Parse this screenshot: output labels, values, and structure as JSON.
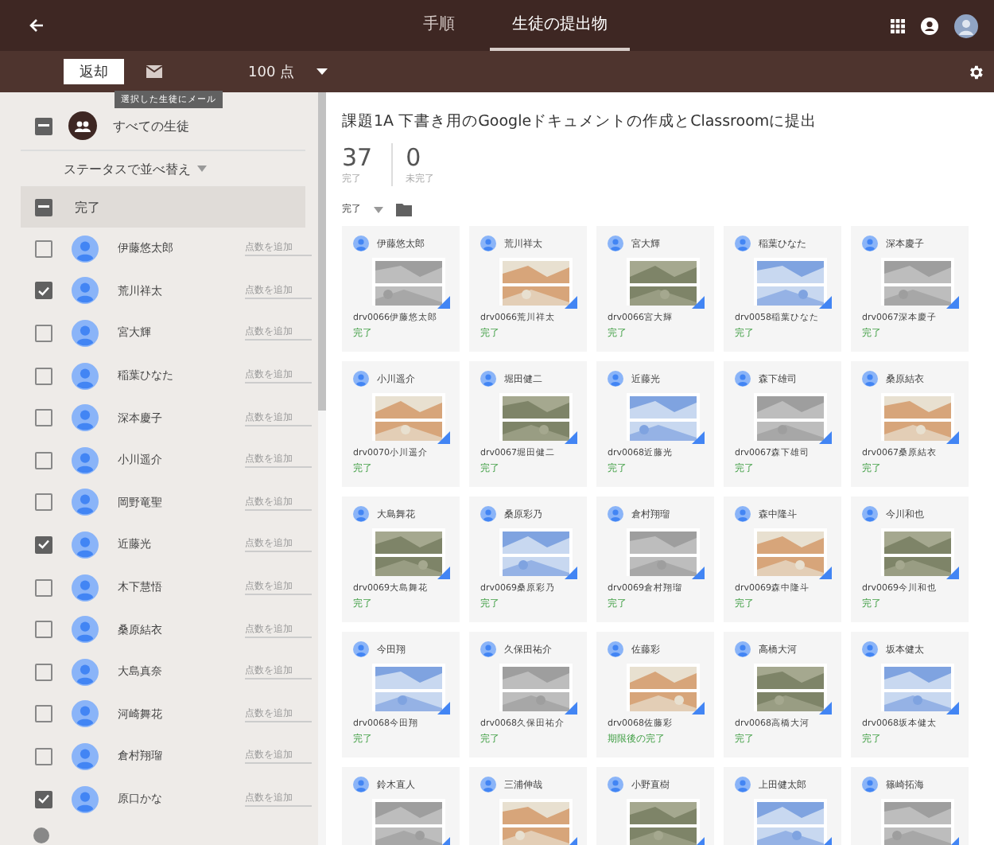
{
  "topbar": {
    "tabs": [
      {
        "label": "手順",
        "selected": false
      },
      {
        "label": "生徒の提出物",
        "selected": true
      }
    ]
  },
  "toolbar": {
    "return_button": "返却",
    "points": "100 点",
    "tooltip": "選択した生徒にメール"
  },
  "sidebar": {
    "all_students": "すべての生徒",
    "all_indeterminate": true,
    "sort": "ステータスで並べ替え",
    "section": "完了",
    "section_indeterminate": true,
    "students": [
      {
        "name": "伊藤悠太郎",
        "checked": false,
        "placeholder": "点数を追加"
      },
      {
        "name": "荒川祥太",
        "checked": true,
        "placeholder": "点数を追加"
      },
      {
        "name": "宮大輝",
        "checked": false,
        "placeholder": "点数を追加"
      },
      {
        "name": "稲葉ひなた",
        "checked": false,
        "placeholder": "点数を追加"
      },
      {
        "name": "深本慶子",
        "checked": false,
        "placeholder": "点数を追加"
      },
      {
        "name": "小川遥介",
        "checked": false,
        "placeholder": "点数を追加"
      },
      {
        "name": "岡野竜聖",
        "checked": false,
        "placeholder": "点数を追加"
      },
      {
        "name": "近藤光",
        "checked": true,
        "placeholder": "点数を追加"
      },
      {
        "name": "木下慧悟",
        "checked": false,
        "placeholder": "点数を追加"
      },
      {
        "name": "桑原結衣",
        "checked": false,
        "placeholder": "点数を追加"
      },
      {
        "name": "大島真奈",
        "checked": false,
        "placeholder": "点数を追加"
      },
      {
        "name": "河崎舞花",
        "checked": false,
        "placeholder": "点数を追加"
      },
      {
        "name": "倉村翔瑠",
        "checked": false,
        "placeholder": "点数を追加"
      },
      {
        "name": "原口かな",
        "checked": true,
        "placeholder": "点数を追加"
      }
    ]
  },
  "assignment": {
    "title": "課題1A 下書き用のGoogleドキュメントの作成とClassroomに提出",
    "stats": [
      {
        "value": "37",
        "label": "完了"
      },
      {
        "value": "0",
        "label": "未完了"
      }
    ],
    "filter": "完了",
    "cards": [
      {
        "name": "伊藤悠太郎",
        "file": "drv0066伊藤悠太郎",
        "status": "完了"
      },
      {
        "name": "荒川祥太",
        "file": "drv0066荒川祥太",
        "status": "完了"
      },
      {
        "name": "宮大輝",
        "file": "drv0066宮大輝",
        "status": "完了"
      },
      {
        "name": "稲葉ひなた",
        "file": "drv0058稲葉ひなた",
        "status": "完了"
      },
      {
        "name": "深本慶子",
        "file": "drv0067深本慶子",
        "status": "完了"
      },
      {
        "name": "小川遥介",
        "file": "drv0070小川遥介",
        "status": "完了"
      },
      {
        "name": "堀田健二",
        "file": "drv0067堀田健二",
        "status": "完了"
      },
      {
        "name": "近藤光",
        "file": "drv0068近藤光",
        "status": "完了"
      },
      {
        "name": "森下雄司",
        "file": "drv0067森下雄司",
        "status": "完了"
      },
      {
        "name": "桑原結衣",
        "file": "drv0067桑原結衣",
        "status": "完了"
      },
      {
        "name": "大島舞花",
        "file": "drv0069大島舞花",
        "status": "完了"
      },
      {
        "name": "桑原彩乃",
        "file": "drv0069桑原彩乃",
        "status": "完了"
      },
      {
        "name": "倉村翔瑠",
        "file": "drv0069倉村翔瑠",
        "status": "完了"
      },
      {
        "name": "森中隆斗",
        "file": "drv0069森中隆斗",
        "status": "完了"
      },
      {
        "name": "今川和也",
        "file": "drv0069今川和也",
        "status": "完了"
      },
      {
        "name": "今田翔",
        "file": "drv0068今田翔",
        "status": "完了"
      },
      {
        "name": "久保田祐介",
        "file": "drv0068久保田祐介",
        "status": "完了"
      },
      {
        "name": "佐藤彩",
        "file": "drv0068佐藤彩",
        "status": "期限後の完了"
      },
      {
        "name": "高橋大河",
        "file": "drv0068高橋大河",
        "status": "完了"
      },
      {
        "name": "坂本健太",
        "file": "drv0068坂本健太",
        "status": "完了"
      },
      {
        "name": "鈴木直人"
      },
      {
        "name": "三浦伸哉"
      },
      {
        "name": "小野直樹"
      },
      {
        "name": "上田健太郎"
      },
      {
        "name": "篠崎拓海"
      }
    ]
  }
}
